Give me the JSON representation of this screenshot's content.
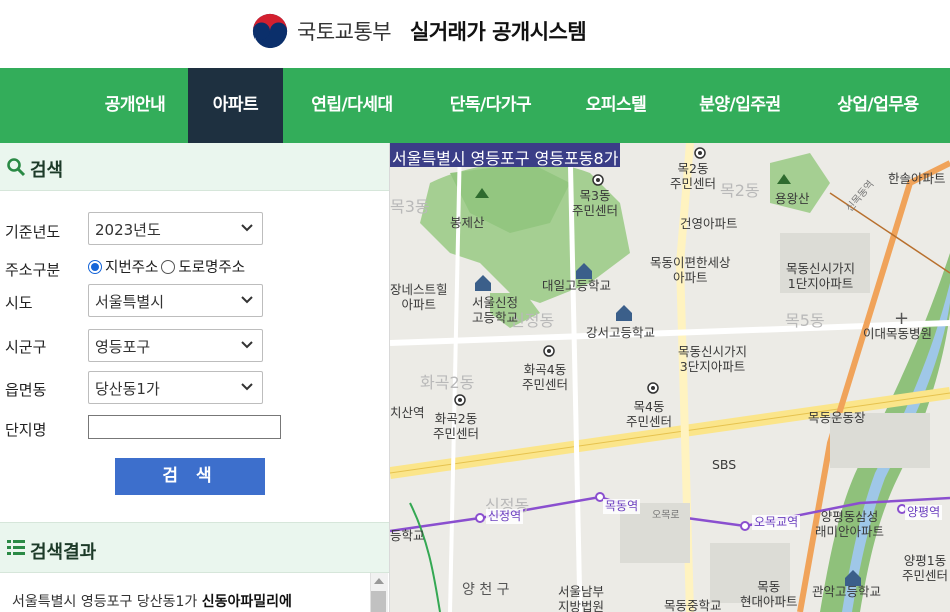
{
  "header": {
    "org_name": "국토교통부",
    "system_name": "실거래가 공개시스템"
  },
  "nav": {
    "items": [
      {
        "label": "공개안내",
        "active": false
      },
      {
        "label": "아파트",
        "active": true
      },
      {
        "label": "연립/다세대",
        "active": false
      },
      {
        "label": "단독/다가구",
        "active": false
      },
      {
        "label": "오피스텔",
        "active": false
      },
      {
        "label": "분양/입주권",
        "active": false
      },
      {
        "label": "상업/업무용",
        "active": false
      }
    ]
  },
  "search": {
    "title": "검색",
    "fields": {
      "year_label": "기준년도",
      "year_value": "2023년도",
      "addr_type_label": "주소구분",
      "addr_lot": "지번주소",
      "addr_road": "도로명주소",
      "sido_label": "시도",
      "sido_value": "서울특별시",
      "sigungu_label": "시군구",
      "sigungu_value": "영등포구",
      "dong_label": "읍면동",
      "dong_value": "당산동1가",
      "complex_label": "단지명",
      "complex_value": ""
    },
    "button": "검 색"
  },
  "results": {
    "title": "검색결과",
    "text_prefix": "서울특별시 영등포구 당산동1가 ",
    "text_bold": "신동아파밀리에"
  },
  "map": {
    "location_title": "서울특별시 영등포구 영등포동8가",
    "labels": {
      "l1": "목2동",
      "l1b": "주민센터",
      "l2": "봉제산",
      "l3": "목3동",
      "l3b": "주민센터",
      "l4": "건영아파트",
      "l5": "용왕산",
      "l6": "한솔아파트",
      "l7": "대일고등학교",
      "l8": "목동이편한세상",
      "l8b": "아파트",
      "l9": "목동신시가지",
      "l9b": "1단지아파트",
      "l10": "장네스트힐",
      "l10b": "아파트",
      "l11": "서울신정",
      "l11b": "고등학교",
      "l12": "강서고등학교",
      "l13": "이대목동병원",
      "l14": "화곡4동",
      "l14b": "주민센터",
      "l15": "목동신시가지",
      "l15b": "3단지아파트",
      "l16": "치산역",
      "l17": "화곡2동",
      "l17b": "주민센터",
      "l18": "목4동",
      "l18b": "주민센터",
      "l19": "목동운동장",
      "l20": "SBS",
      "l21": "신정역",
      "l22": "목동역",
      "l23": "오목교역",
      "l24": "양평역",
      "l25": "양평동삼성",
      "l25b": "래미안아파트",
      "l26": "양평1동",
      "l26b": "주민센터",
      "l27": "양 천 구",
      "l28": "서울남부",
      "l28b": "지방법원",
      "l29": "목동중학교",
      "l30": "목동",
      "l30b": "현대아파트",
      "l31": "관악고등학교",
      "l32": "등학교",
      "l33": "오목로",
      "l34": "신목동역",
      "a1": "목2동",
      "a2": "목5동",
      "a3": "화곡2동",
      "a4": "신정동",
      "a5": "신정동",
      "a6": "목3동"
    }
  }
}
